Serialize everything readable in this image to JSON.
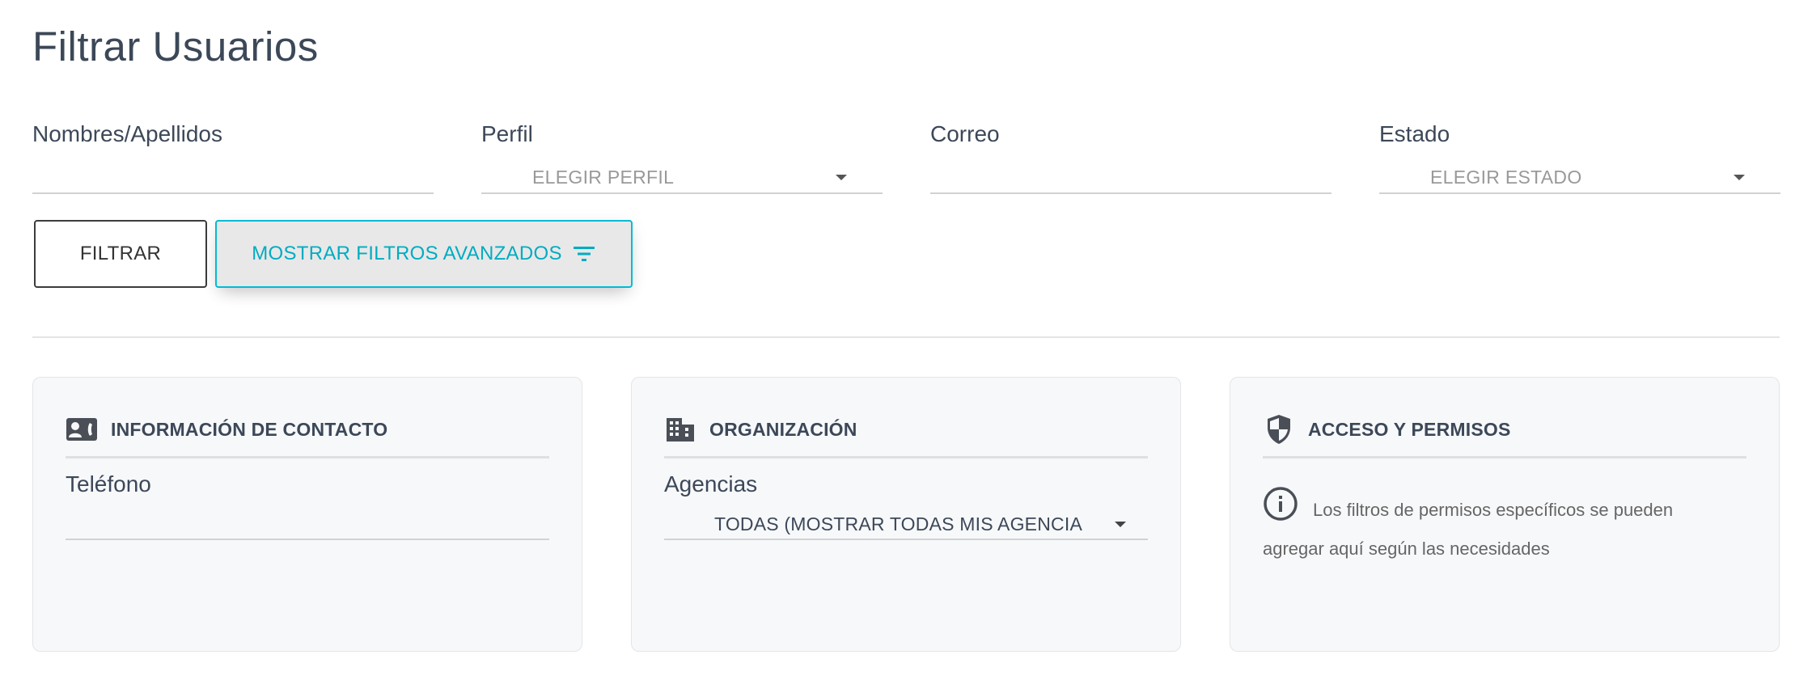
{
  "page": {
    "title": "Filtrar Usuarios"
  },
  "filters": {
    "name_label": "Nombres/Apellidos",
    "name_value": "",
    "profile_label": "Perfil",
    "profile_placeholder": "ELEGIR PERFIL",
    "email_label": "Correo",
    "email_value": "",
    "status_label": "Estado",
    "status_placeholder": "ELEGIR ESTADO"
  },
  "buttons": {
    "filter_label": "FILTRAR",
    "advanced_label": "MOSTRAR FILTROS AVANZADOS",
    "advanced_icon": "filter-list-icon"
  },
  "cards": {
    "contact": {
      "icon": "contact-card-icon",
      "title": "INFORMACIÓN DE CONTACTO",
      "phone_label": "Teléfono",
      "phone_value": ""
    },
    "organization": {
      "icon": "building-icon",
      "title": "ORGANIZACIÓN",
      "agencies_label": "Agencias",
      "agencies_selected": "TODAS (MOSTRAR TODAS MIS AGENCIA"
    },
    "access": {
      "icon": "shield-icon",
      "title": "ACCESO Y PERMISOS",
      "info_icon": "info-icon",
      "info_text": "Los filtros de permisos específicos se pueden agregar aquí según las necesidades"
    }
  },
  "colors": {
    "accent": "#00bcd4",
    "text": "#3c4858",
    "muted": "#999999",
    "card_bg": "#f7f8fa"
  }
}
